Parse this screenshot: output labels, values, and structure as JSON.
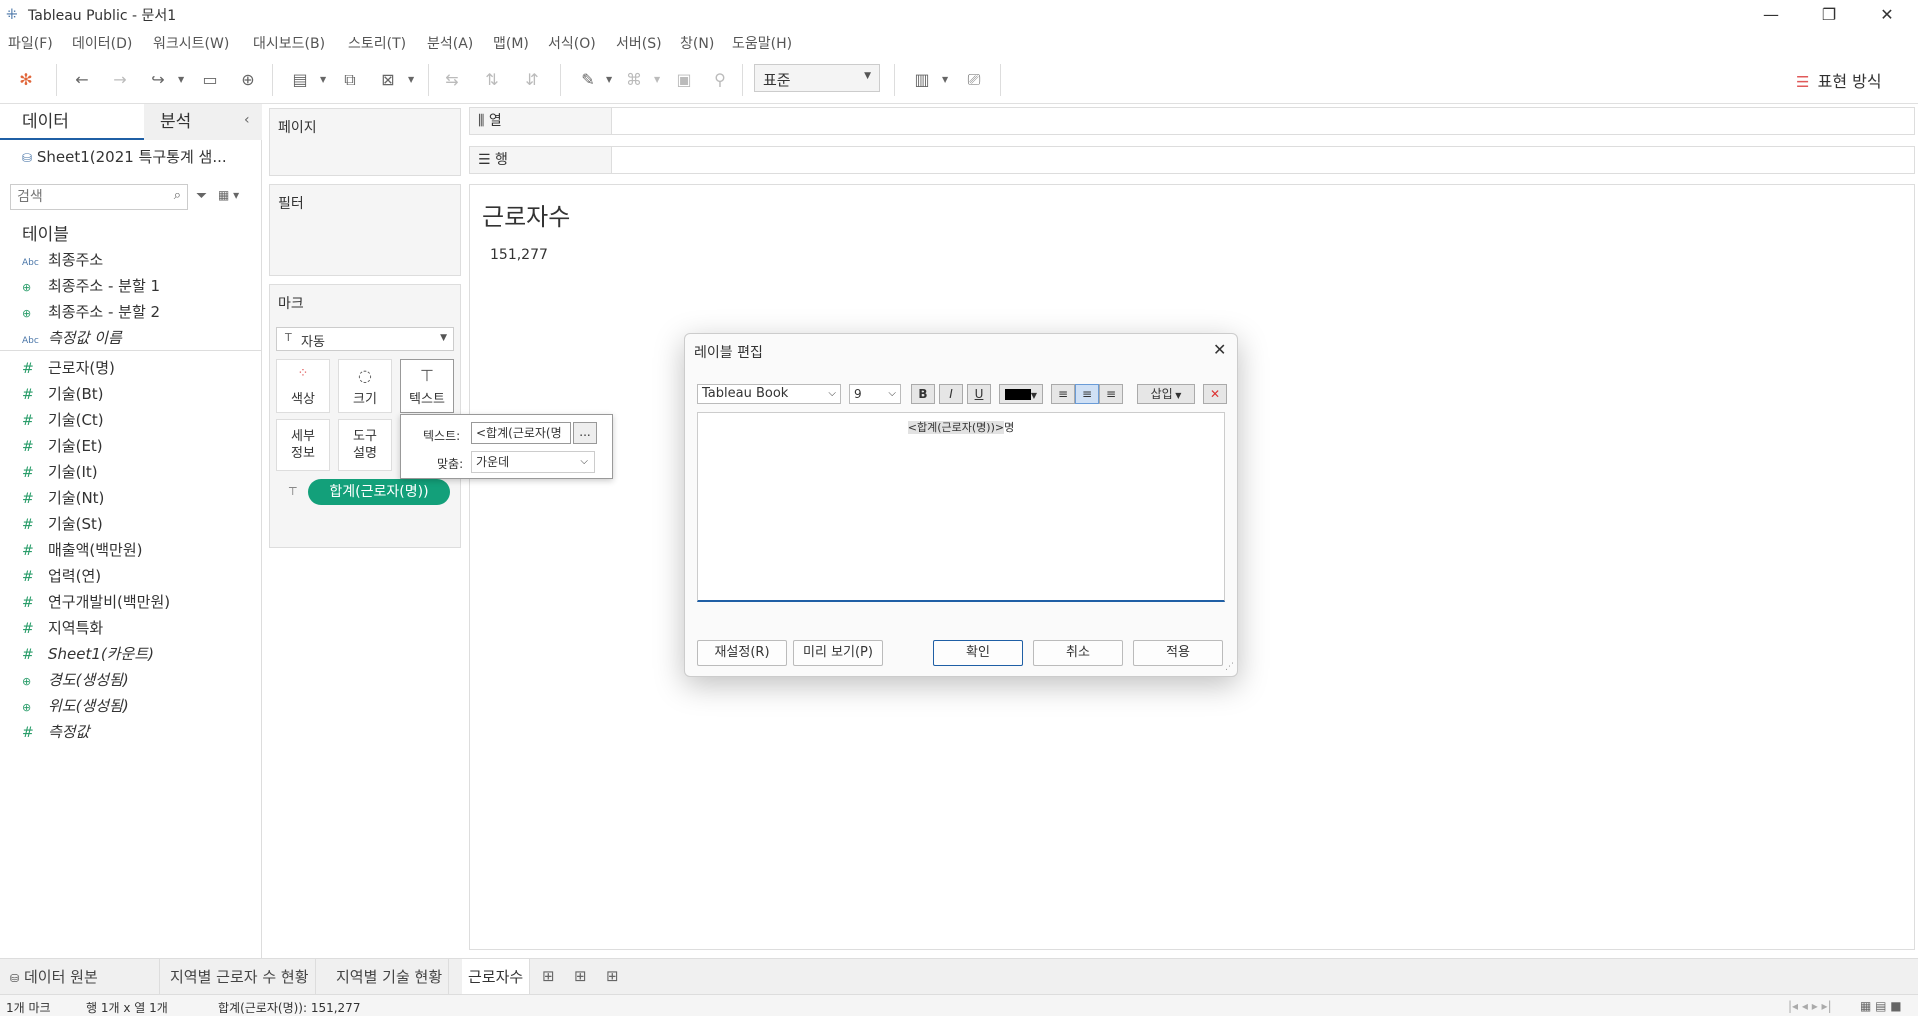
{
  "window": {
    "title": "Tableau Public - 문서1",
    "minimize": "—",
    "restore": "❐",
    "close": "✕"
  },
  "menu": [
    "파일(F)",
    "데이터(D)",
    "워크시트(W)",
    "대시보드(B)",
    "스토리(T)",
    "분석(A)",
    "맵(M)",
    "서식(O)",
    "서버(S)",
    "창(N)",
    "도움말(H)"
  ],
  "toolbar": {
    "view_size": "표준",
    "show_me": "표현 방식"
  },
  "left_panel": {
    "tab_data": "데이터",
    "tab_analysis": "분석",
    "datasource": "Sheet1(2021 특구통계 샘...",
    "search_placeholder": "검색",
    "tables_header": "테이블",
    "fields": [
      {
        "name": "최종주소",
        "type": "Abc",
        "italic": false
      },
      {
        "name": "최종주소 - 분할 1",
        "type": "geo",
        "italic": false
      },
      {
        "name": "최종주소 - 분할 2",
        "type": "geo",
        "italic": false
      },
      {
        "name": "측정값 이름",
        "type": "Abc",
        "italic": true
      },
      {
        "name": "근로자(명)",
        "type": "#",
        "italic": false
      },
      {
        "name": "기술(Bt)",
        "type": "#",
        "italic": false
      },
      {
        "name": "기술(Ct)",
        "type": "#",
        "italic": false
      },
      {
        "name": "기술(Et)",
        "type": "#",
        "italic": false
      },
      {
        "name": "기술(It)",
        "type": "#",
        "italic": false
      },
      {
        "name": "기술(Nt)",
        "type": "#",
        "italic": false
      },
      {
        "name": "기술(St)",
        "type": "#",
        "italic": false
      },
      {
        "name": "매출액(백만원)",
        "type": "#",
        "italic": false
      },
      {
        "name": "업력(연)",
        "type": "#",
        "italic": false
      },
      {
        "name": "연구개발비(백만원)",
        "type": "#",
        "italic": false
      },
      {
        "name": "지역특화",
        "type": "#",
        "italic": false
      },
      {
        "name": "Sheet1(카운트)",
        "type": "#",
        "italic": true
      },
      {
        "name": "경도(생성됨)",
        "type": "geo",
        "italic": true
      },
      {
        "name": "위도(생성됨)",
        "type": "geo",
        "italic": true
      },
      {
        "name": "측정값",
        "type": "#",
        "italic": true
      }
    ]
  },
  "cards": {
    "pages": "페이지",
    "filters": "필터",
    "marks": "마크",
    "mark_type": "자동",
    "color": "색상",
    "size": "크기",
    "text": "텍스트",
    "detail_1": "세부",
    "detail_2": "정보",
    "tooltip_1": "도구",
    "tooltip_2": "설명",
    "pill": "합계(근로자(명))"
  },
  "shelves": {
    "columns": "열",
    "rows": "행"
  },
  "view": {
    "title": "근로자수",
    "value": "151,277"
  },
  "text_popup": {
    "text_label": "텍스트:",
    "text_value": "<합계(근로자(명",
    "more": "...",
    "align_label": "맞춤:",
    "align_value": "가운데"
  },
  "dialog": {
    "title": "레이블 편집",
    "font": "Tableau Book",
    "size": "9",
    "bold": "B",
    "italic": "I",
    "underline": "U",
    "insert": "삽입",
    "field_token": "<합계(근로자(명))>",
    "suffix": "명",
    "reset": "재설정(R)",
    "preview": "미리 보기(P)",
    "ok": "확인",
    "cancel": "취소",
    "apply": "적용",
    "text_color": "#000000"
  },
  "sheet_tabs": {
    "datasource": "데이터 원본",
    "tabs": [
      "지역별 근로자 수 현황",
      "지역별 기술 현황",
      "근로자수"
    ]
  },
  "status": {
    "marks": "1개 마크",
    "rows_cols": "행 1개 x 열 1개",
    "sum": "합계(근로자(명)): 151,277"
  }
}
